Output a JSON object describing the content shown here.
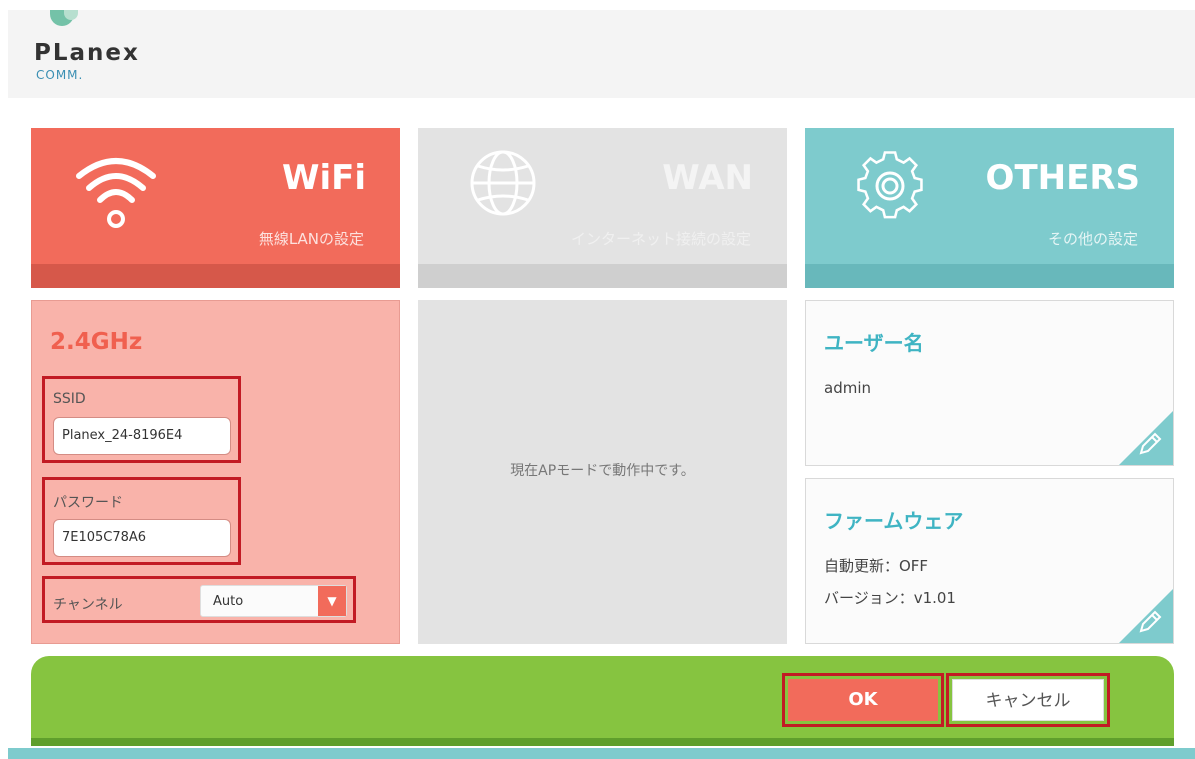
{
  "brand": {
    "name": "PLanex",
    "sub": "COMM."
  },
  "tiles": [
    {
      "title": "WiFi",
      "subtitle": "無線LANの設定",
      "icon": "wifi-icon",
      "color": "#f26b5b"
    },
    {
      "title": "WAN",
      "subtitle": "インターネット接続の設定",
      "icon": "globe-icon",
      "color": "#e3e3e3"
    },
    {
      "title": "OTHERS",
      "subtitle": "その他の設定",
      "icon": "gear-icon",
      "color": "#7ecbcd"
    }
  ],
  "wifi": {
    "band": "2.4GHz",
    "ssid_label": "SSID",
    "ssid_value": "Planex_24-8196E4",
    "password_label": "パスワード",
    "password_value": "7E105C78A6",
    "channel_label": "チャンネル",
    "channel_value": "Auto"
  },
  "wan": {
    "message": "現在APモードで動作中です。"
  },
  "others": {
    "user": {
      "title": "ユーザー名",
      "value": "admin"
    },
    "firmware": {
      "title": "ファームウェア",
      "auto_update": "自動更新：OFF",
      "version": "バージョン：v1.01"
    }
  },
  "footer": {
    "ok_label": "OK",
    "cancel_label": "キャンセル"
  },
  "colors": {
    "accent": "#f26b5b",
    "teal": "#7ecbcd",
    "green": "#86c440",
    "highlight": "#c21b24"
  }
}
